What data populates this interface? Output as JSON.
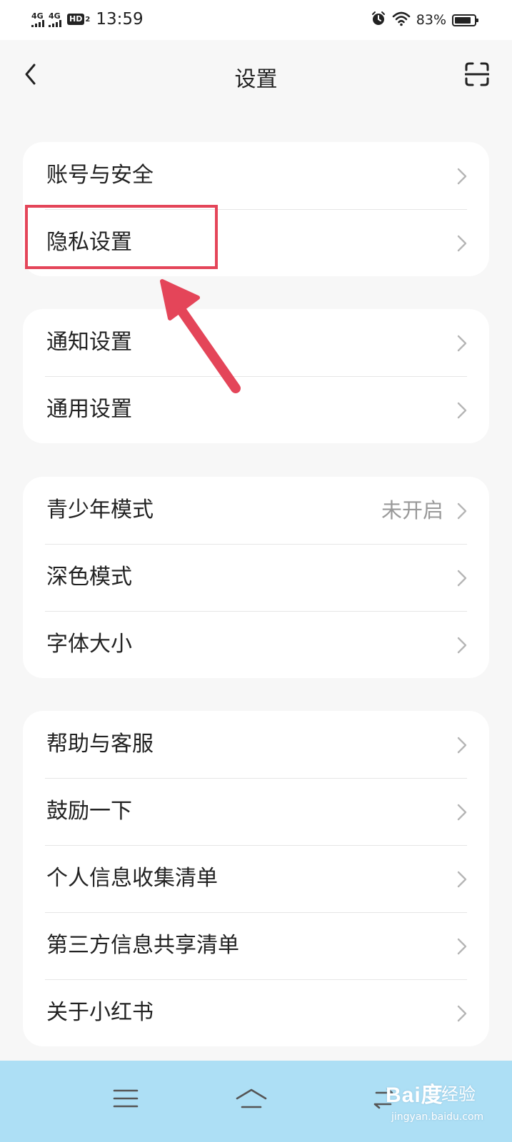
{
  "status_bar": {
    "signal_1": "4G",
    "signal_2": "4G",
    "hd_label": "HD",
    "hd_sub": "2",
    "time": "13:59",
    "battery_text": "83%",
    "battery_level": 0.83,
    "icons": [
      "alarm-icon",
      "wifi-icon",
      "battery-icon"
    ]
  },
  "header": {
    "title": "设置",
    "back_icon": "chevron-left-icon",
    "scan_icon": "scan-icon"
  },
  "groups": [
    {
      "items": [
        {
          "label": "账号与安全"
        },
        {
          "label": "隐私设置"
        }
      ]
    },
    {
      "items": [
        {
          "label": "通知设置"
        },
        {
          "label": "通用设置"
        }
      ]
    },
    {
      "items": [
        {
          "label": "青少年模式",
          "value": "未开启"
        },
        {
          "label": "深色模式"
        },
        {
          "label": "字体大小"
        }
      ]
    },
    {
      "items": [
        {
          "label": "帮助与客服"
        },
        {
          "label": "鼓励一下"
        },
        {
          "label": "个人信息收集清单"
        },
        {
          "label": "第三方信息共享清单"
        },
        {
          "label": "关于小红书"
        }
      ]
    }
  ],
  "annotation": {
    "color": "#e44559",
    "highlighted_item": "隐私设置"
  },
  "nav_bar": {
    "background": "#addff5",
    "icons": [
      "menu-icon",
      "home-icon",
      "back-swap-icon"
    ]
  },
  "watermark": {
    "logo": "Bai度",
    "text": "经验",
    "url": "jingyan.baidu.com"
  }
}
